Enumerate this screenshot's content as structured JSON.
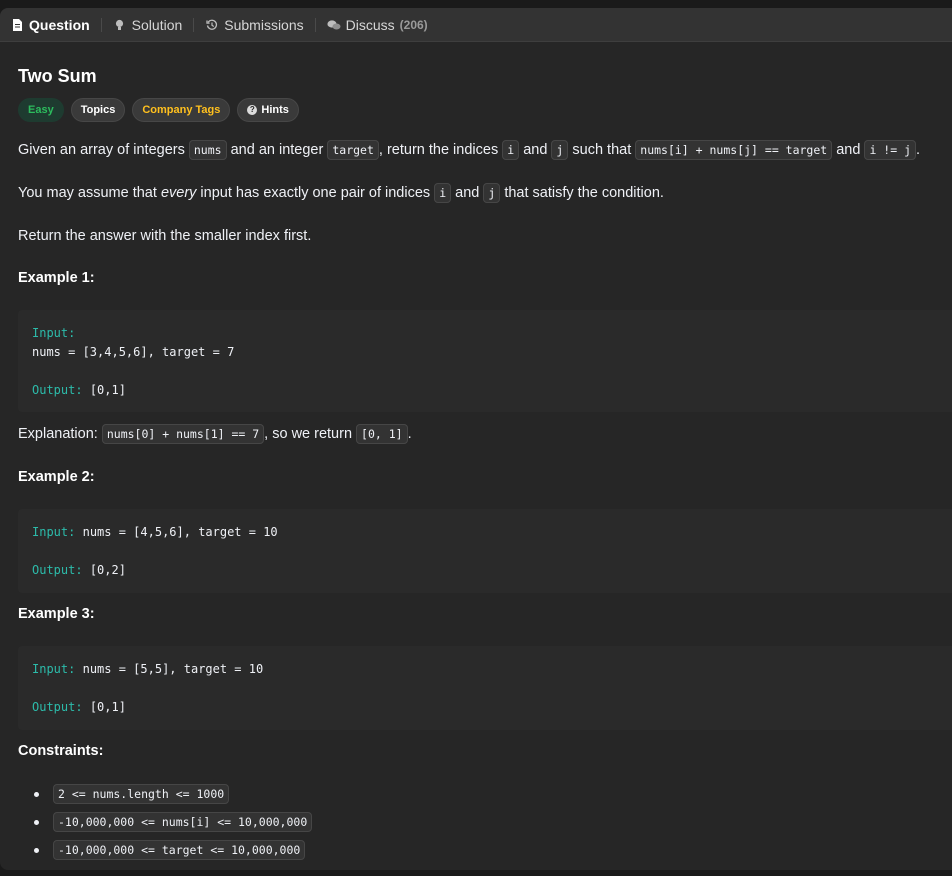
{
  "tabs": [
    {
      "label": "Question",
      "icon": "document-icon"
    },
    {
      "label": "Solution",
      "icon": "lightbulb-icon"
    },
    {
      "label": "Submissions",
      "icon": "history-icon"
    },
    {
      "label": "Discuss",
      "icon": "chat-icon",
      "count": "(206)"
    }
  ],
  "problem": {
    "title": "Two Sum",
    "tags": {
      "difficulty": "Easy",
      "topics": "Topics",
      "company": "Company Tags",
      "hints": "Hints"
    },
    "desc": {
      "p1": {
        "t1": "Given an array of integers ",
        "c1": "nums",
        "t2": " and an integer ",
        "c2": "target",
        "t3": ", return the indices ",
        "c3": "i",
        "t4": " and ",
        "c4": "j",
        "t5": " such that ",
        "c5": "nums[i] + nums[j] == target",
        "t6": " and ",
        "c6": "i != j",
        "t7": "."
      },
      "p2": {
        "t1": "You may assume that ",
        "em": "every",
        "t2": " input has exactly one pair of indices ",
        "c1": "i",
        "t3": " and ",
        "c2": "j",
        "t4": " that satisfy the condition."
      },
      "p3": "Return the answer with the smaller index first."
    },
    "examples": [
      {
        "heading": "Example 1:",
        "input_label": "Input:",
        "input_value": "nums = [3,4,5,6], target = 7",
        "output_label": "Output:",
        "output_value": "[0,1]",
        "explanation": {
          "label": "Explanation: ",
          "code1": "nums[0] + nums[1] == 7",
          "text": ", so we return ",
          "code2": "[0, 1]",
          "end": "."
        }
      },
      {
        "heading": "Example 2:",
        "input_label": "Input:",
        "input_value": "nums = [4,5,6], target = 10",
        "output_label": "Output:",
        "output_value": "[0,2]"
      },
      {
        "heading": "Example 3:",
        "input_label": "Input:",
        "input_value": "nums = [5,5], target = 10",
        "output_label": "Output:",
        "output_value": "[0,1]"
      }
    ],
    "constraints_heading": "Constraints:",
    "constraints": [
      "2 <= nums.length <= 1000",
      "-10,000,000 <= nums[i] <= 10,000,000",
      "-10,000,000 <= target <= 10,000,000"
    ]
  },
  "colors": {
    "background": "#262626",
    "easy": "#2cbb5d",
    "company": "#ffc01e",
    "code_label": "#2cbbaa"
  }
}
